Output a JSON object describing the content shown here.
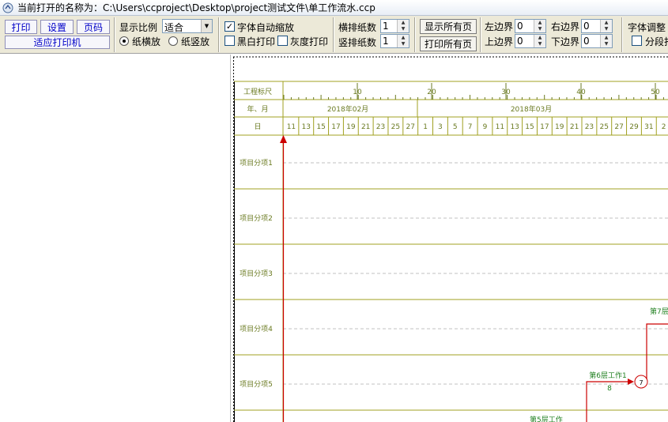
{
  "window": {
    "title": "当前打开的名称为：C:\\Users\\ccproject\\Desktop\\project测试文件\\单工作流水.ccp"
  },
  "toolbar": {
    "print_label": "打印",
    "settings_label": "设置",
    "page_label": "页码",
    "fit_printer_label": "适应打印机",
    "scale_label": "显示比例",
    "scale_value": "适合",
    "landscape_label": "纸横放",
    "portrait_label": "纸竖放",
    "orientation_selected": "landscape",
    "font_autoscale_label": "字体自动缩放",
    "font_autoscale_checked": true,
    "bw_print_label": "黑白打印",
    "gray_print_label": "灰度打印",
    "h_pages_label": "横排纸数",
    "h_pages_value": "1",
    "v_pages_label": "竖排纸数",
    "v_pages_value": "1",
    "show_all_label": "显示所有页",
    "print_all_label": "打印所有页",
    "left_margin_label": "左边界",
    "left_margin_value": "0",
    "right_margin_label": "右边界",
    "right_margin_value": "0",
    "top_margin_label": "上边界",
    "top_margin_value": "0",
    "bottom_margin_label": "下边界",
    "bottom_margin_value": "0",
    "font_adjust_label": "字体调整",
    "segment_label": "分段打"
  },
  "schedule": {
    "ruler_label": "工程标尺",
    "month_row_label": "年、月",
    "day_row_label": "日",
    "ruler_ticks": [
      "10",
      "20",
      "30",
      "40",
      "50"
    ],
    "months": [
      "2018年02月",
      "2018年03月"
    ],
    "days": [
      "11",
      "13",
      "15",
      "17",
      "19",
      "21",
      "23",
      "25",
      "27",
      "1",
      "3",
      "5",
      "7",
      "9",
      "11",
      "13",
      "15",
      "17",
      "19",
      "21",
      "23",
      "25",
      "27",
      "29",
      "31",
      "2"
    ],
    "rows": [
      "项目分项1",
      "项目分项2",
      "项目分项3",
      "项目分项4",
      "项目分项5"
    ],
    "tasks": [
      {
        "label": "第6层工作1",
        "duration": "8",
        "node": "7"
      },
      {
        "label": "第7层",
        "duration": "",
        "node": ""
      },
      {
        "label": "第5层工作",
        "duration": "",
        "node": ""
      }
    ],
    "line_color": "#cc0000",
    "grid_color": "#a0a020",
    "text_color": "#6a7a20",
    "task_text_color": "#208020"
  }
}
